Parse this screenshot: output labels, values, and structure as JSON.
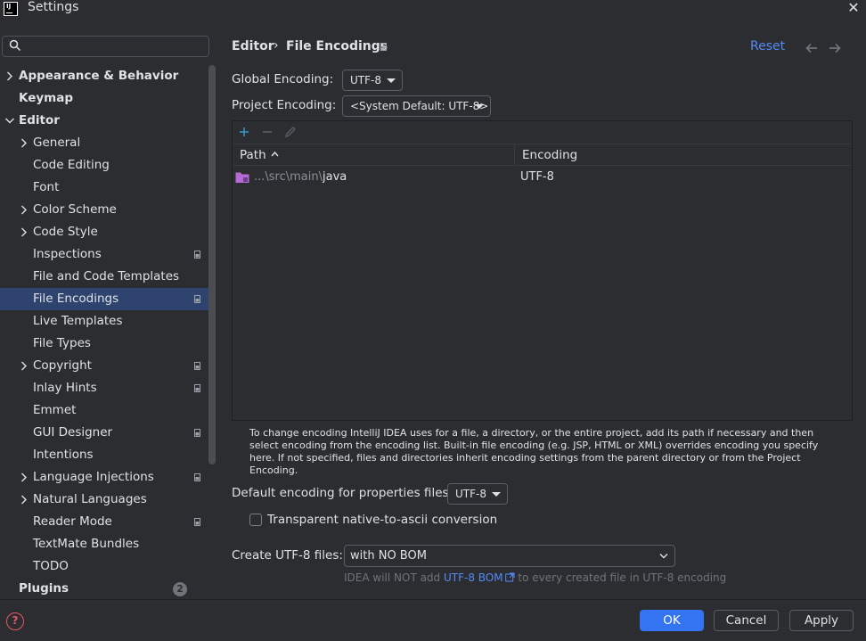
{
  "window": {
    "logo_text": "IJ",
    "title": "Settings",
    "close_glyph": "✕"
  },
  "sidebar": {
    "search_placeholder": "",
    "items": [
      {
        "label": "Appearance & Behavior",
        "level": 0,
        "chevron": "right",
        "bold": true
      },
      {
        "label": "Keymap",
        "level": 0,
        "chevron": "none",
        "bold": true
      },
      {
        "label": "Editor",
        "level": 0,
        "chevron": "down",
        "bold": true
      },
      {
        "label": "General",
        "level": 1,
        "chevron": "right"
      },
      {
        "label": "Code Editing",
        "level": 1,
        "chevron": "none"
      },
      {
        "label": "Font",
        "level": 1,
        "chevron": "none"
      },
      {
        "label": "Color Scheme",
        "level": 1,
        "chevron": "right"
      },
      {
        "label": "Code Style",
        "level": 1,
        "chevron": "right"
      },
      {
        "label": "Inspections",
        "level": 1,
        "chevron": "none",
        "badge": true
      },
      {
        "label": "File and Code Templates",
        "level": 1,
        "chevron": "none"
      },
      {
        "label": "File Encodings",
        "level": 1,
        "chevron": "none",
        "badge": true,
        "selected": true
      },
      {
        "label": "Live Templates",
        "level": 1,
        "chevron": "none"
      },
      {
        "label": "File Types",
        "level": 1,
        "chevron": "none"
      },
      {
        "label": "Copyright",
        "level": 1,
        "chevron": "right",
        "badge": true
      },
      {
        "label": "Inlay Hints",
        "level": 1,
        "chevron": "none",
        "badge": true
      },
      {
        "label": "Emmet",
        "level": 1,
        "chevron": "none"
      },
      {
        "label": "GUI Designer",
        "level": 1,
        "chevron": "none",
        "badge": true
      },
      {
        "label": "Intentions",
        "level": 1,
        "chevron": "none"
      },
      {
        "label": "Language Injections",
        "level": 1,
        "chevron": "right",
        "badge": true
      },
      {
        "label": "Natural Languages",
        "level": 1,
        "chevron": "right"
      },
      {
        "label": "Reader Mode",
        "level": 1,
        "chevron": "none",
        "badge": true
      },
      {
        "label": "TextMate Bundles",
        "level": 1,
        "chevron": "none"
      },
      {
        "label": "TODO",
        "level": 1,
        "chevron": "none"
      },
      {
        "label": "Plugins",
        "level": 0,
        "chevron": "none",
        "bold": true
      }
    ],
    "plugins_count": "2"
  },
  "breadcrumb": {
    "root": "Editor",
    "separator": "›",
    "current": "File Encodings"
  },
  "header": {
    "reset_label": "Reset"
  },
  "global_encoding": {
    "label": "Global Encoding:",
    "value": "UTF-8"
  },
  "project_encoding": {
    "label": "Project Encoding:",
    "value": "<System Default: UTF-8>"
  },
  "table": {
    "columns": {
      "path": "Path",
      "path_sort": "^",
      "encoding": "Encoding"
    },
    "rows": [
      {
        "path_prefix": "...\\src\\main\\",
        "path_name": "java",
        "encoding": "UTF-8"
      }
    ]
  },
  "help_text": "To change encoding IntelliJ IDEA uses for a file, a directory, or the entire project, add its path if necessary and then select encoding from the encoding list. Built-in file encoding (e.g. JSP, HTML or XML) overrides encoding you specify here. If not specified, files and directories inherit encoding settings from the parent directory or from the Project Encoding.",
  "properties_encoding": {
    "label": "Default encoding for properties files:",
    "value": "UTF-8"
  },
  "native_to_ascii": {
    "label": "Transparent native-to-ascii conversion",
    "checked": false
  },
  "create_utf8": {
    "label": "Create UTF-8 files:",
    "value": "with NO BOM",
    "hint_before": "IDEA will NOT add ",
    "hint_link": "UTF-8 BOM",
    "hint_after": " to every created file in UTF-8 encoding"
  },
  "footer": {
    "help_glyph": "?",
    "ok_label": "OK",
    "cancel_label": "Cancel",
    "apply_label": "Apply"
  },
  "colors": {
    "background": "#2b2d30",
    "selection": "#2e436e",
    "accent": "#3574f0",
    "link": "#548af7",
    "folder_icon": "#b36bd6"
  }
}
